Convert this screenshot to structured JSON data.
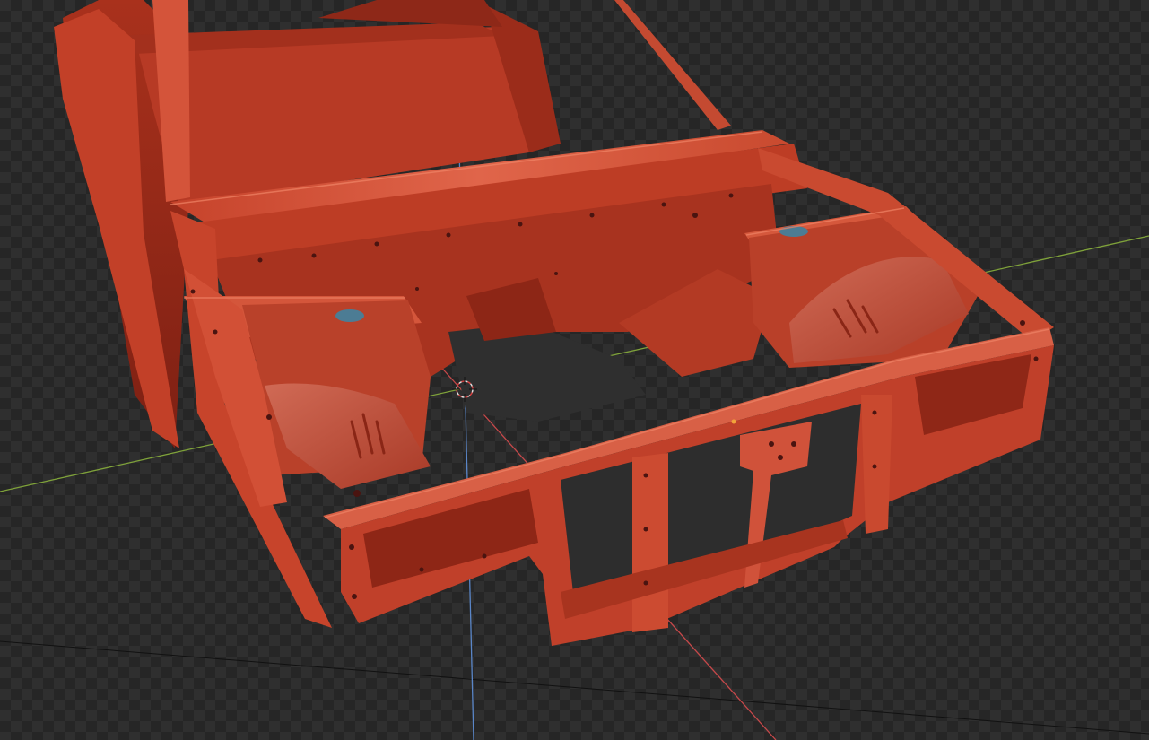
{
  "viewport": {
    "mode": "rendered",
    "background": "checkerboard",
    "axes": {
      "x_axis_color": "#c7484a",
      "y_axis_color": "#7fa23a",
      "z_axis_color": "#5a86c8"
    },
    "model": {
      "name": "",
      "body_color": "#c8422c",
      "shadow_color": "#8f2418",
      "highlight_color": "#e2654a",
      "hole_color": "#4a1410",
      "cap_color": "#4c7c94"
    },
    "cursor_3d": {
      "colors": [
        "#e0e0e0",
        "#d04040"
      ]
    }
  }
}
